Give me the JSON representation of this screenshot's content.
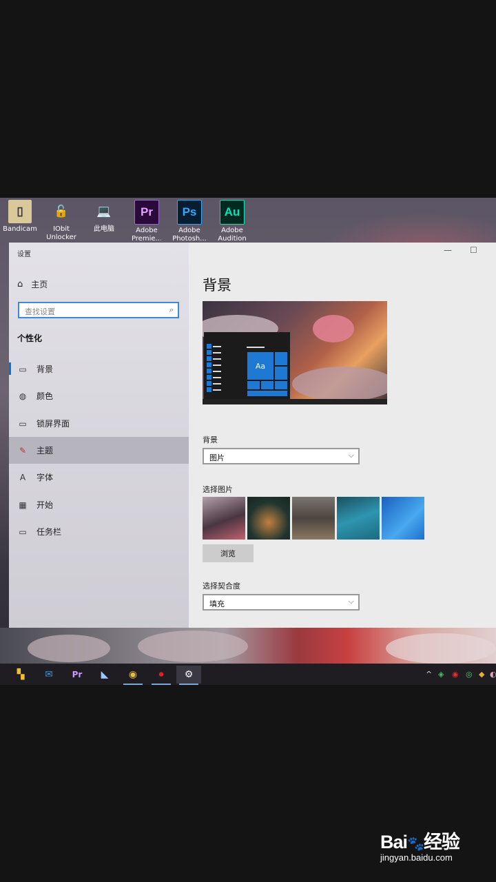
{
  "desktop": {
    "icons": [
      {
        "label": "Bandicam",
        "glyph": "▯",
        "bg": "#d9c89a",
        "fg": "#333"
      },
      {
        "label": "IObit Unlocker",
        "glyph": "🔓",
        "bg": "transparent",
        "fg": "#f0c040"
      },
      {
        "label": "此电脑",
        "glyph": "💻",
        "bg": "transparent",
        "fg": "#7fc0f0"
      },
      {
        "label": "Adobe Premie...",
        "glyph": "Pr",
        "bg": "#2a0a3a",
        "fg": "#e8a0ff"
      },
      {
        "label": "Adobe Photosh...",
        "glyph": "Ps",
        "bg": "#061e30",
        "fg": "#31a8ff"
      },
      {
        "label": "Adobe Audition",
        "glyph": "Au",
        "bg": "#002a20",
        "fg": "#00e4bb"
      }
    ]
  },
  "window": {
    "title": "设置",
    "minimize_glyph": "—",
    "maximize_glyph": "☐"
  },
  "sidebar": {
    "home_icon": "⌂",
    "home_label": "主页",
    "search_placeholder": "查找设置",
    "search_icon": "⌕",
    "section_title": "个性化",
    "items": [
      {
        "icon": "▭",
        "label": "背景"
      },
      {
        "icon": "◍",
        "label": "颜色"
      },
      {
        "icon": "▭",
        "label": "锁屏界面"
      },
      {
        "icon": "✎",
        "label": "主题"
      },
      {
        "icon": "A",
        "label": "字体"
      },
      {
        "icon": "▦",
        "label": "开始"
      },
      {
        "icon": "▭",
        "label": "任务栏"
      }
    ]
  },
  "content": {
    "heading": "背景",
    "preview_tile_text": "Aa",
    "bg_label": "背景",
    "bg_value": "图片",
    "choose_label": "选择图片",
    "browse_label": "浏览",
    "fit_label": "选择契合度",
    "fit_value": "填充",
    "chevron": "⌵",
    "thumb_colors": [
      [
        "#b0a0aa",
        "#4a3540",
        "#c06070"
      ],
      [
        "#1a2520",
        "#c08040",
        "#203530"
      ],
      [
        "#7a7470",
        "#4d4540",
        "#8a7860"
      ],
      [
        "#1a6a80",
        "#2f95b0",
        "#1a5060"
      ],
      [
        "#1e6fd0",
        "#48a8ee",
        "#1a60c0"
      ]
    ]
  },
  "taskbar": {
    "apps": [
      {
        "name": "start",
        "glyph": "▚",
        "color": "#f0c030"
      },
      {
        "name": "mail",
        "glyph": "✉",
        "color": "#3a9ae0"
      },
      {
        "name": "premiere",
        "glyph": "Pr",
        "color": "#c89aff"
      },
      {
        "name": "feishu",
        "glyph": "◣",
        "color": "#9ec8ff"
      },
      {
        "name": "chrome",
        "glyph": "◉",
        "color": "#e8c040"
      },
      {
        "name": "bandicam",
        "glyph": "⏺",
        "color": "#e02020"
      },
      {
        "name": "settings",
        "glyph": "⚙",
        "color": "#ffffff"
      }
    ],
    "tray": [
      "^",
      "◈",
      "◉",
      "◎",
      "◆",
      "◐"
    ]
  },
  "watermark": {
    "logo_a": "Bai",
    "paw": "🐾",
    "logo_b": "经验",
    "url": "jingyan.baidu.com"
  }
}
